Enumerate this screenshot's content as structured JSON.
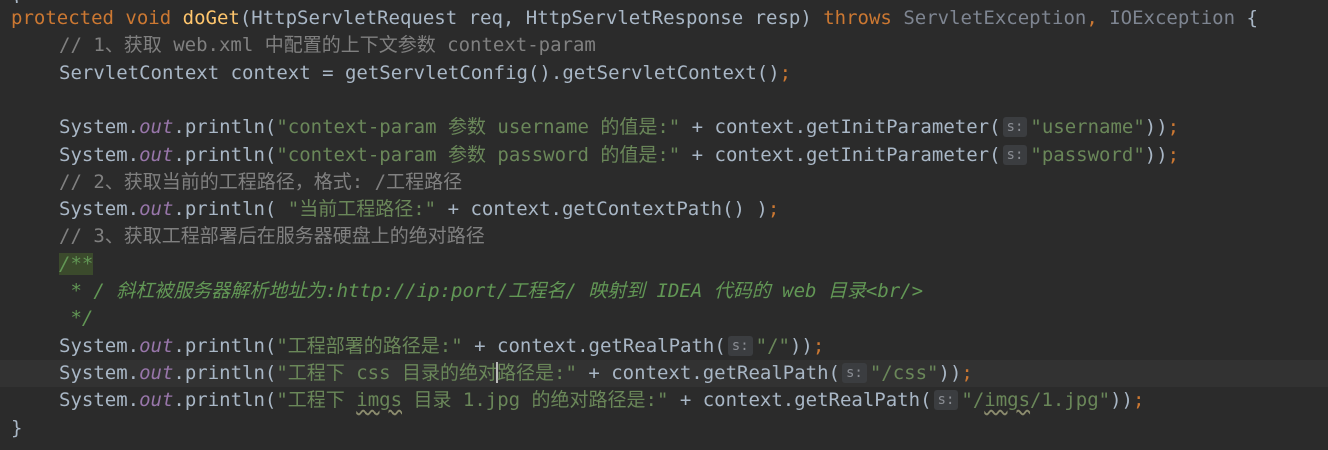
{
  "editor": {
    "top_stub": "{",
    "lines": [
      {
        "indent": 0,
        "tokens": [
          {
            "t": "protected",
            "c": "kw"
          },
          {
            "t": " ",
            "c": ""
          },
          {
            "t": "void",
            "c": "kw"
          },
          {
            "t": " ",
            "c": ""
          },
          {
            "t": "doGet",
            "c": "fn"
          },
          {
            "t": "(HttpServletRequest req, HttpServletResponse resp) ",
            "c": "cls"
          },
          {
            "t": "throws",
            "c": "kw"
          },
          {
            "t": " ",
            "c": ""
          },
          {
            "t": "ServletException",
            "c": "gray"
          },
          {
            "t": ", ",
            "c": "kw"
          },
          {
            "t": "IOException",
            "c": "gray"
          },
          {
            "t": " {",
            "c": "cls"
          }
        ]
      },
      {
        "indent": 1,
        "tokens": [
          {
            "t": "// 1、获取 web.xml 中配置的上下文参数 context-param",
            "c": "cm"
          }
        ]
      },
      {
        "indent": 1,
        "tokens": [
          {
            "t": "ServletContext context = getServletConfig().getServletContext()",
            "c": "cls"
          },
          {
            "t": ";",
            "c": "kw"
          }
        ]
      },
      {
        "indent": 1,
        "tokens": []
      },
      {
        "indent": 1,
        "tokens": [
          {
            "t": "System.",
            "c": "cls"
          },
          {
            "t": "out",
            "c": "fld"
          },
          {
            "t": ".println(",
            "c": "cls"
          },
          {
            "t": "\"context-param 参数 username 的值是:\"",
            "c": "str"
          },
          {
            "t": " + context.getInitParameter(",
            "c": "cls"
          },
          {
            "h": "s:"
          },
          {
            "t": "\"username\"",
            "c": "str"
          },
          {
            "t": "))",
            "c": "cls"
          },
          {
            "t": ";",
            "c": "kw"
          }
        ]
      },
      {
        "indent": 1,
        "tokens": [
          {
            "t": "System.",
            "c": "cls"
          },
          {
            "t": "out",
            "c": "fld"
          },
          {
            "t": ".println(",
            "c": "cls"
          },
          {
            "t": "\"context-param 参数 password 的值是:\"",
            "c": "str"
          },
          {
            "t": " + context.getInitParameter(",
            "c": "cls"
          },
          {
            "h": "s:"
          },
          {
            "t": "\"password\"",
            "c": "str"
          },
          {
            "t": "))",
            "c": "cls"
          },
          {
            "t": ";",
            "c": "kw"
          }
        ]
      },
      {
        "indent": 1,
        "tokens": [
          {
            "t": "// 2、获取当前的工程路径，格式: /工程路径",
            "c": "cm"
          }
        ]
      },
      {
        "indent": 1,
        "tokens": [
          {
            "t": "System.",
            "c": "cls"
          },
          {
            "t": "out",
            "c": "fld"
          },
          {
            "t": ".println( ",
            "c": "cls"
          },
          {
            "t": "\"当前工程路径:\"",
            "c": "str"
          },
          {
            "t": " + context.getContextPath() )",
            "c": "cls"
          },
          {
            "t": ";",
            "c": "kw"
          }
        ]
      },
      {
        "indent": 1,
        "tokens": [
          {
            "t": "// 3、获取工程部署后在服务器硬盘上的绝对路径",
            "c": "cm"
          }
        ]
      },
      {
        "indent": 1,
        "tokens": [
          {
            "t": "/**",
            "c": "doc doc-open"
          }
        ]
      },
      {
        "indent": 1,
        "tokens": [
          {
            "t": " * / 斜杠被服务器解析地址为:http://ip:port/工程名/ 映射到 IDEA 代码的 web 目录<br/>",
            "c": "doc"
          }
        ]
      },
      {
        "indent": 1,
        "tokens": [
          {
            "t": " */",
            "c": "doc"
          }
        ]
      },
      {
        "indent": 1,
        "tokens": [
          {
            "t": "System.",
            "c": "cls"
          },
          {
            "t": "out",
            "c": "fld"
          },
          {
            "t": ".println(",
            "c": "cls"
          },
          {
            "t": "\"工程部署的路径是:\"",
            "c": "str"
          },
          {
            "t": " + context.getRealPath(",
            "c": "cls"
          },
          {
            "h": "s:"
          },
          {
            "t": "\"/\"",
            "c": "str"
          },
          {
            "t": "))",
            "c": "cls"
          },
          {
            "t": ";",
            "c": "kw"
          }
        ]
      },
      {
        "indent": 1,
        "current": true,
        "tokens": [
          {
            "t": "System.",
            "c": "cls"
          },
          {
            "t": "out",
            "c": "fld"
          },
          {
            "t": ".println(",
            "c": "cls"
          },
          {
            "t": "\"工程下 css 目录的绝对",
            "c": "str"
          },
          {
            "caret": true
          },
          {
            "t": "路径是:\"",
            "c": "str"
          },
          {
            "t": " + context.getRealPath(",
            "c": "cls"
          },
          {
            "h": "s:"
          },
          {
            "t": "\"/css\"",
            "c": "str"
          },
          {
            "t": "))",
            "c": "cls"
          },
          {
            "t": ";",
            "c": "kw"
          }
        ]
      },
      {
        "indent": 1,
        "tokens": [
          {
            "t": "System.",
            "c": "cls"
          },
          {
            "t": "out",
            "c": "fld"
          },
          {
            "t": ".println(",
            "c": "cls"
          },
          {
            "t": "\"工程下 ",
            "c": "str"
          },
          {
            "t": "imgs",
            "c": "str ul"
          },
          {
            "t": " 目录 1.jpg 的绝对路径是:\"",
            "c": "str"
          },
          {
            "t": " + context.getRealPath(",
            "c": "cls"
          },
          {
            "h": "s:"
          },
          {
            "t": "\"/",
            "c": "str"
          },
          {
            "t": "imgs",
            "c": "str ul"
          },
          {
            "t": "/1.jpg\"",
            "c": "str"
          },
          {
            "t": "))",
            "c": "cls"
          },
          {
            "t": ";",
            "c": "kw"
          }
        ]
      },
      {
        "indent": 0,
        "tokens": [
          {
            "t": "}",
            "c": "cls"
          }
        ]
      }
    ]
  }
}
